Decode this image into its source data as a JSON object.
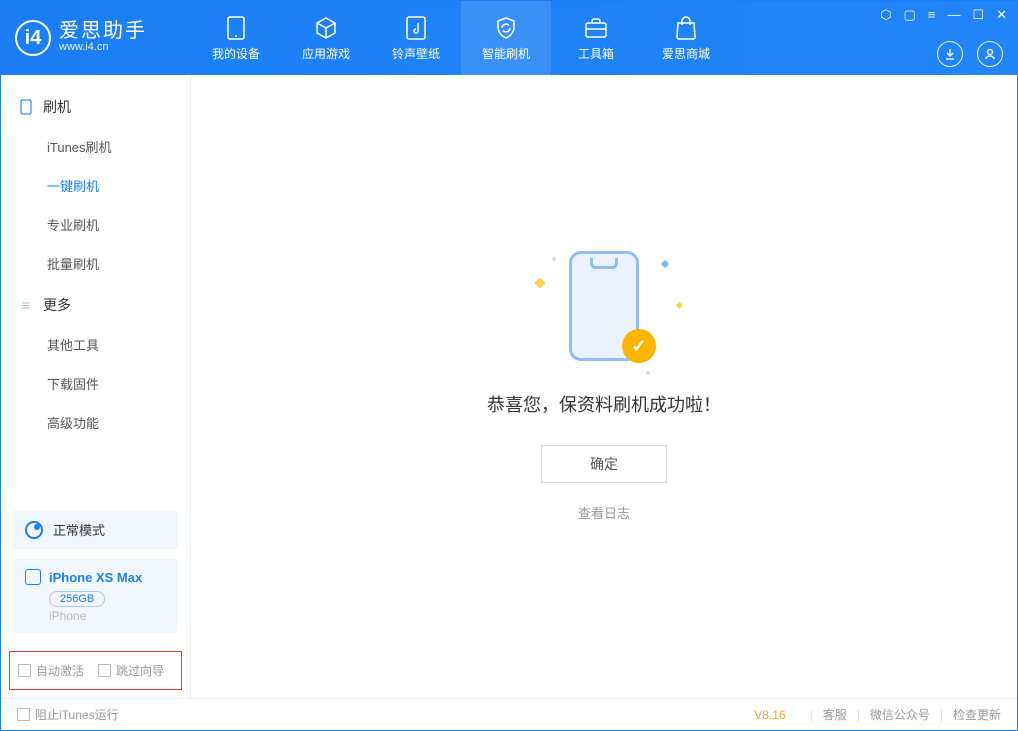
{
  "app": {
    "name": "爱思助手",
    "domain": "www.i4.cn"
  },
  "tabs": [
    {
      "label": "我的设备"
    },
    {
      "label": "应用游戏"
    },
    {
      "label": "铃声壁纸"
    },
    {
      "label": "智能刷机"
    },
    {
      "label": "工具箱"
    },
    {
      "label": "爱思商城"
    }
  ],
  "sidebar": {
    "group1_title": "刷机",
    "group1": [
      {
        "label": "iTunes刷机"
      },
      {
        "label": "一键刷机"
      },
      {
        "label": "专业刷机"
      },
      {
        "label": "批量刷机"
      }
    ],
    "group2_title": "更多",
    "group2": [
      {
        "label": "其他工具"
      },
      {
        "label": "下载固件"
      },
      {
        "label": "高级功能"
      }
    ],
    "mode": "正常模式",
    "device_name": "iPhone XS Max",
    "device_storage": "256GB",
    "device_type": "iPhone",
    "cb_auto_activate": "自动激活",
    "cb_skip_guide": "跳过向导"
  },
  "main": {
    "success_msg": "恭喜您，保资料刷机成功啦！",
    "ok": "确定",
    "view_log": "查看日志"
  },
  "footer": {
    "block_itunes": "阻止iTunes运行",
    "version": "V8.16",
    "support": "客服",
    "wechat": "微信公众号",
    "check_update": "检查更新"
  }
}
